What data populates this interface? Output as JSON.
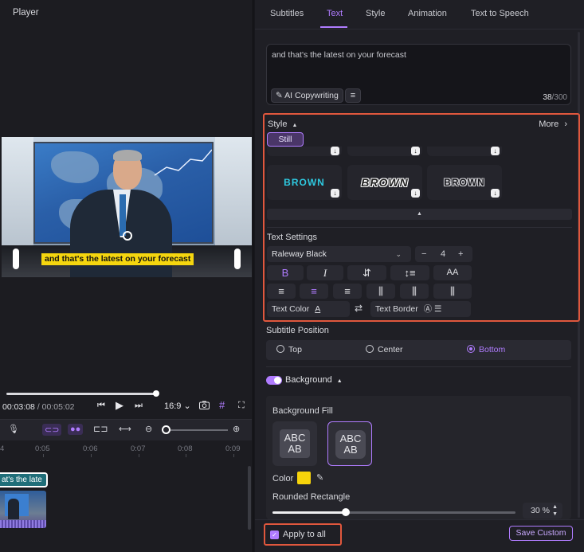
{
  "player": {
    "title": "Player",
    "caption": "and that's the latest on your forecast",
    "time_current": "00:03:08",
    "time_total": "/ 00:05:02",
    "aspect": "16:9",
    "progress": 0.6
  },
  "timeline": {
    "ruler": [
      "4",
      "0:05",
      "0:06",
      "0:07",
      "0:08",
      "0:09"
    ],
    "text_clip": "at's the late"
  },
  "tabs": [
    {
      "label": "Subtitles"
    },
    {
      "label": "Text",
      "active": true
    },
    {
      "label": "Style"
    },
    {
      "label": "Animation"
    },
    {
      "label": "Text to Speech"
    }
  ],
  "text_editor": {
    "content": "and that's the latest on your forecast",
    "ai_button": "AI Copywriting",
    "count": "38",
    "max": "/300"
  },
  "style": {
    "label": "Style",
    "more": "More",
    "still": "Still",
    "presets": [
      "BROWN",
      "BROWN",
      "BROWN"
    ]
  },
  "text_settings": {
    "label": "Text Settings",
    "font": "Raleway Black",
    "size": "4",
    "text_color": "Text Color",
    "text_border": "Text Border"
  },
  "subtitle_position": {
    "label": "Subtitle Position",
    "options": [
      "Top",
      "Center",
      "Bottom"
    ],
    "selected": "Bottom"
  },
  "background": {
    "label": "Background",
    "fill_label": "Background Fill",
    "fill_sample": "ABC AB",
    "color_label": "Color",
    "color": "#f7d40b",
    "rounded_label": "Rounded Rectangle",
    "rounded_value": "30 %",
    "rounded_fraction": 0.3
  },
  "footer": {
    "apply_all": "Apply to all",
    "save_custom": "Save Custom"
  },
  "colors": {
    "accent": "#b07cff",
    "highlight_border": "#e0573d"
  }
}
